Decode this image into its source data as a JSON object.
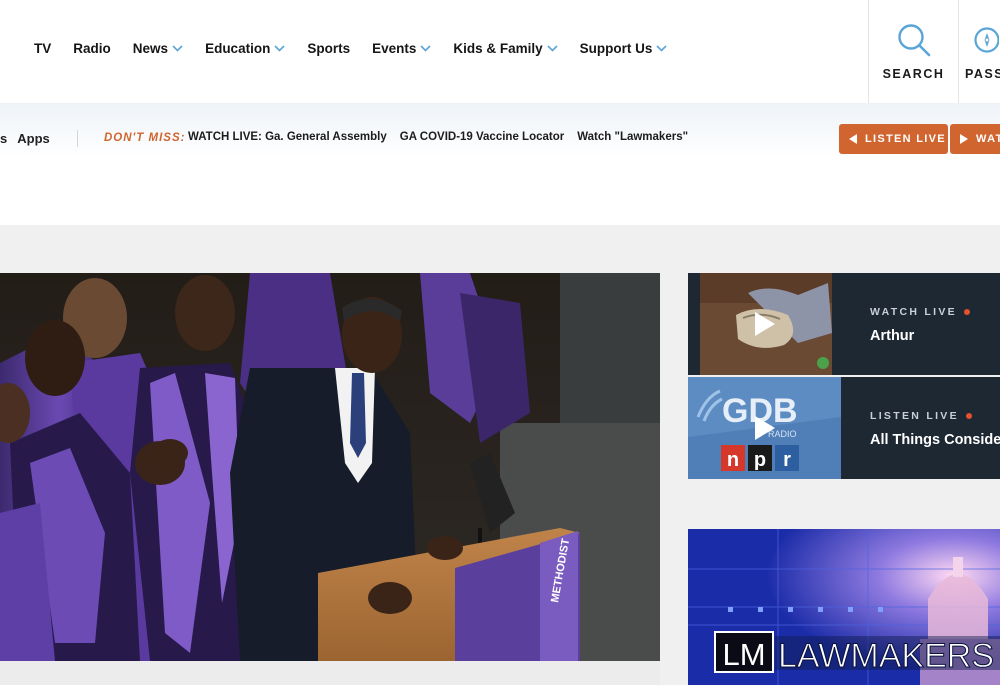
{
  "nav": {
    "items": [
      {
        "label": "TV",
        "dropdown": false
      },
      {
        "label": "Radio",
        "dropdown": false
      },
      {
        "label": "News",
        "dropdown": true
      },
      {
        "label": "Education",
        "dropdown": true
      },
      {
        "label": "Sports",
        "dropdown": false
      },
      {
        "label": "Events",
        "dropdown": true
      },
      {
        "label": "Kids & Family",
        "dropdown": true
      },
      {
        "label": "Support Us",
        "dropdown": true
      }
    ],
    "search_label": "SEARCH",
    "passport_label": "PASS",
    "accent_color": "#5aa5d8"
  },
  "subbar": {
    "partial_left": "s",
    "apps_label": "Apps",
    "dont_miss_label": "DON'T MISS:",
    "links": [
      "WATCH LIVE: Ga. General Assembly",
      "GA COVID-19 Vaccine Locator",
      "Watch \"Lawmakers\""
    ],
    "listen_live_label": "LISTEN LIVE",
    "watch_live_label": "WAT",
    "button_color": "#d0652f"
  },
  "live": [
    {
      "label": "WATCH LIVE",
      "title": "Arthur"
    },
    {
      "label": "LISTEN LIVE",
      "title": "All Things Considered"
    }
  ],
  "thumb_text": {
    "gdb": "GDB",
    "radio": "RADIO",
    "npr": [
      "n",
      "p",
      "r"
    ]
  },
  "hero": {
    "podium_text": "METHODIST"
  },
  "promo": {
    "logo": "LM",
    "name": "LAWMAKERS"
  }
}
